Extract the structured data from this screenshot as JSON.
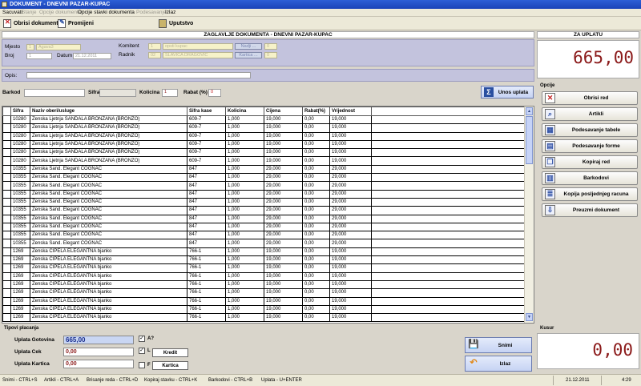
{
  "window": {
    "title": "DOKUMENT - DNEVNI PAZAR-KUPAC"
  },
  "menu": [
    "Sacuvati",
    "Stanje",
    "Opcije dokumenta",
    "Opcije stavki dokumenta",
    "Podesavanje",
    "Izlaz"
  ],
  "toolbar": {
    "delete_doc": "Obrisi dokument",
    "change": "Promijeni",
    "help": "Uputstvo"
  },
  "header": {
    "title": "ZAGLAVLJE DOKUMENTA - DNEVNI PAZAR-KUPAC",
    "mjesto_label": "Mjesto",
    "mjesto_code": "1",
    "mjesto_name": "Agava3",
    "broj_label": "Broj",
    "broj_value": "1",
    "datum_label": "Datum",
    "datum_value": "21.12.2011",
    "komitent_label": "Komitent",
    "komitent_code": "1",
    "komitent_name": "opsti kupac",
    "nadji_label": "Nadji ...",
    "komitent_extra": "0",
    "radnik_label": "Radnik",
    "radnik_code": "02",
    "radnik_name": "SLAVICA DRAGOVIC",
    "kartica_label": "Kartica ...",
    "radnik_extra": "0",
    "opis_label": "Opis:",
    "opis_value": ""
  },
  "entry": {
    "barkod_label": "Barkod",
    "barkod_value": "",
    "sifra_label": "Sifra",
    "sifra_value": "",
    "kolicina_label": "Kolicina",
    "kolicina_value": "1",
    "rabat_label": "Rabat (%)",
    "rabat_value": "0",
    "unos_label": "Unos uplata"
  },
  "grid": {
    "columns": [
      "Sifra",
      "Naziv oberi/usluge",
      "Sifra kase",
      "Kolicina",
      "Cijena",
      "Rabat(%)",
      "Vrijednost"
    ],
    "rows": [
      [
        "10280",
        "Zenska Ljetnja SANDALA BRONZANA (BRONZO)",
        "609-7",
        "1,000",
        "19,000",
        "0,00",
        "19,000"
      ],
      [
        "10280",
        "Zenska Ljetnja SANDALA BRONZANA (BRONZO)",
        "609-7",
        "1,000",
        "19,000",
        "0,00",
        "19,000"
      ],
      [
        "10280",
        "Zenska Ljetnja SANDALA BRONZANA (BRONZO)",
        "609-7",
        "1,000",
        "19,000",
        "0,00",
        "19,000"
      ],
      [
        "10280",
        "Zenska Ljetnja SANDALA BRONZANA (BRONZO)",
        "609-7",
        "1,000",
        "19,000",
        "0,00",
        "19,000"
      ],
      [
        "10280",
        "Zenska Ljetnja SANDALA BRONZANA (BRONZO)",
        "609-7",
        "1,000",
        "19,000",
        "0,00",
        "19,000"
      ],
      [
        "10280",
        "Zenska Ljetnja SANDALA BRONZANA (BRONZO)",
        "609-7",
        "1,000",
        "19,000",
        "0,00",
        "19,000"
      ],
      [
        "10355",
        "Zenska Sand. Elegant COGNAC",
        "847",
        "1,000",
        "29,000",
        "0,00",
        "29,000"
      ],
      [
        "10355",
        "Zenska Sand. Elegant COGNAC",
        "847",
        "1,000",
        "29,000",
        "0,00",
        "29,000"
      ],
      [
        "10355",
        "Zenska Sand. Elegant COGNAC",
        "847",
        "1,000",
        "29,000",
        "0,00",
        "29,000"
      ],
      [
        "10355",
        "Zenska Sand. Elegant COGNAC",
        "847",
        "1,000",
        "29,000",
        "0,00",
        "29,000"
      ],
      [
        "10355",
        "Zenska Sand. Elegant COGNAC",
        "847",
        "1,000",
        "29,000",
        "0,00",
        "29,000"
      ],
      [
        "10355",
        "Zenska Sand. Elegant COGNAC",
        "847",
        "1,000",
        "29,000",
        "0,00",
        "29,000"
      ],
      [
        "10355",
        "Zenska Sand. Elegant COGNAC",
        "847",
        "1,000",
        "29,000",
        "0,00",
        "29,000"
      ],
      [
        "10355",
        "Zenska Sand. Elegant COGNAC",
        "847",
        "1,000",
        "29,000",
        "0,00",
        "29,000"
      ],
      [
        "10355",
        "Zenska Sand. Elegant COGNAC",
        "847",
        "1,000",
        "29,000",
        "0,00",
        "29,000"
      ],
      [
        "10355",
        "Zenska Sand. Elegant COGNAC",
        "847",
        "1,000",
        "29,000",
        "0,00",
        "29,000"
      ],
      [
        "1269",
        "Zenska CIPELA ELEGANTNA bjanko",
        "766-1",
        "1,000",
        "19,000",
        "0,00",
        "19,000"
      ],
      [
        "1269",
        "Zenska CIPELA ELEGANTNA bjanko",
        "766-1",
        "1,000",
        "19,000",
        "0,00",
        "19,000"
      ],
      [
        "1269",
        "Zenska CIPELA ELEGANTNA bjanko",
        "766-1",
        "1,000",
        "19,000",
        "0,00",
        "19,000"
      ],
      [
        "1269",
        "Zenska CIPELA ELEGANTNA bjanko",
        "766-1",
        "1,000",
        "19,000",
        "0,00",
        "19,000"
      ],
      [
        "1269",
        "Zenska CIPELA ELEGANTNA bjanko",
        "766-1",
        "1,000",
        "19,000",
        "0,00",
        "19,000"
      ],
      [
        "1269",
        "Zenska CIPELA ELEGANTNA bjanko",
        "766-1",
        "1,000",
        "19,000",
        "0,00",
        "19,000"
      ],
      [
        "1269",
        "Zenska CIPELA ELEGANTNA bjanko",
        "766-1",
        "1,000",
        "19,000",
        "0,00",
        "19,000"
      ],
      [
        "1269",
        "Zenska CIPELA ELEGANTNA bjanko",
        "766-1",
        "1,000",
        "19,000",
        "0,00",
        "19,000"
      ],
      [
        "1269",
        "Zenska CIPELA ELEGANTNA bjanko",
        "766-1",
        "1,000",
        "19,000",
        "0,00",
        "19,000"
      ]
    ]
  },
  "right": {
    "za_uplatu_label": "ZA UPLATU",
    "za_uplatu_value": "665,00",
    "opcije_label": "Opcije",
    "options": [
      {
        "name": "obrisi-red",
        "label": "Obrisi red",
        "icon": "delete-icon"
      },
      {
        "name": "artikli",
        "label": "Artikli",
        "icon": "search-icon"
      },
      {
        "name": "podesavanje-tabele",
        "label": "Podesavanje tabele",
        "icon": "table-icon"
      },
      {
        "name": "podesavanje-forme",
        "label": "Podesavanje forme",
        "icon": "form-icon"
      },
      {
        "name": "kopiraj-red",
        "label": "Kopiraj red",
        "icon": "copy-icon"
      },
      {
        "name": "barkodovi",
        "label": "Barkodovi",
        "icon": "barcode-icon"
      },
      {
        "name": "kopija-racuna",
        "label": "Kopija posljednjeg racuna",
        "icon": "receipt-icon"
      },
      {
        "name": "preuzmi-dokument",
        "label": "Preuzmi dokument",
        "icon": "download-icon"
      }
    ],
    "kusur_label": "Kusur",
    "kusur_value": "0,00"
  },
  "payment": {
    "title": "Tipovi placanja",
    "gotovina_label": "Uplata Gotovina",
    "gotovina_value": "665,00",
    "cek_label": "Uplata Cek",
    "cek_value": "0,00",
    "kartica_label": "Uplata Kartica",
    "kartica_value": "0,00",
    "cb_a_label": "A?",
    "cb_l_label": "L",
    "cb_f_label": "F",
    "kredit_label": "Kredit",
    "kartica_btn_label": "Kartica",
    "snimi_label": "Snimi",
    "izlaz_label": "Izlaz"
  },
  "status": {
    "items": [
      "Snimi - CTRL+S",
      "Artikli - CTRL+A",
      "Brisanje reda - CTRL+D",
      "Kopiraj stavku - CTRL+K",
      "Barkodovi - CTRL+B",
      "Uplata - U+ENTER"
    ],
    "date": "21.12.2011",
    "time": "4:29"
  },
  "colors": {
    "accent_red": "#8b1a1a",
    "panel_lavender": "#c3c3dd",
    "titlebar_blue": "#1a43b8"
  }
}
